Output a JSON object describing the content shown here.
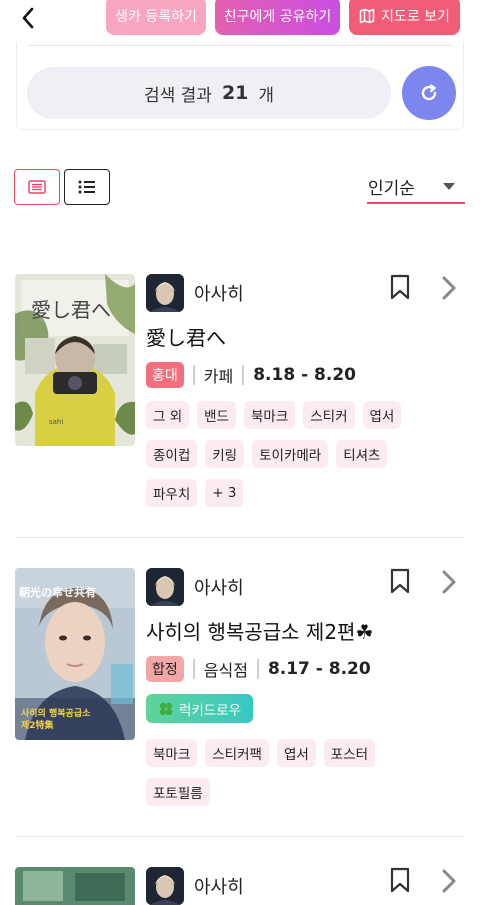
{
  "topbar": {
    "back_icon": "chevron-left-icon",
    "register_label": "생카 등록하기",
    "share_label": "친구에게 공유하기",
    "map_label": "지도로 보기",
    "map_icon": "map-icon"
  },
  "search": {
    "prefix": "검색 결과",
    "count": "21",
    "suffix": "개",
    "refresh_icon": "refresh-icon"
  },
  "view": {
    "card_icon": "card-view-icon",
    "list_icon": "list-view-icon",
    "active": "card"
  },
  "sort": {
    "selected": "인기순"
  },
  "colors": {
    "accent": "#e04a66",
    "register": "#f7a5c2",
    "share": "#d356cb",
    "map": "#f15c78",
    "refresh": "#7c86ee",
    "tag_bg": "#fdecef"
  },
  "items": [
    {
      "username": "아사히",
      "title": "愛し君へ",
      "region": "홍대",
      "category": "카페",
      "dates": "8.18 - 8.20",
      "tags": [
        "그 외",
        "밴드",
        "북마크",
        "스티커",
        "엽서",
        "종이컵",
        "키링",
        "토이카메라",
        "티셔츠",
        "파우치",
        "+ 3"
      ],
      "thumb_text": "愛し君へ"
    },
    {
      "username": "아사히",
      "title": "사히의 행복공급소 제2편☘",
      "region": "합정",
      "category": "음식점",
      "dates": "8.17 - 8.20",
      "badge": "럭키드로우",
      "tags": [
        "북마크",
        "스티커팩",
        "엽서",
        "포스터",
        "포토필름"
      ],
      "thumb_text": "朝光の幸せ共有",
      "thumb_sub": "사히의 행복공급소 제2特集"
    },
    {
      "username": "아사히"
    }
  ]
}
